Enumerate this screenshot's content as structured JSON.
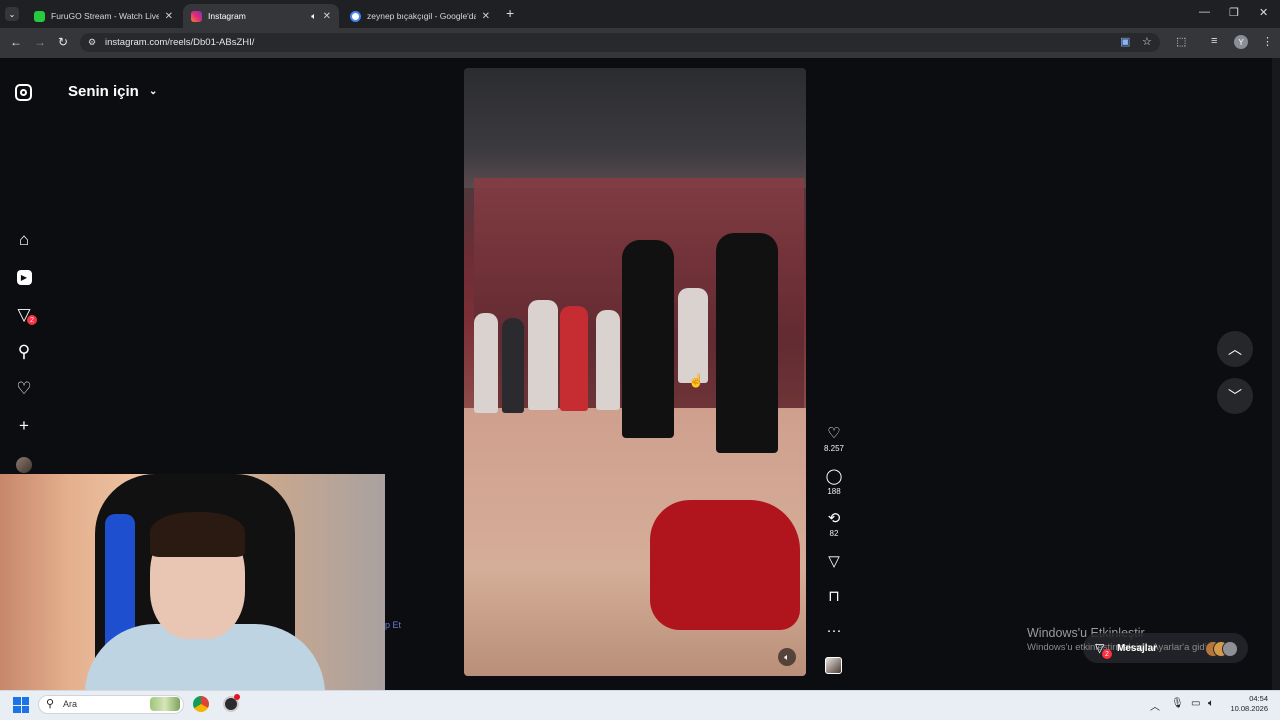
{
  "browser": {
    "tabs": [
      {
        "title": "FuruGO Stream - Watch Live on",
        "favicon_color": "#27c93f",
        "active": false
      },
      {
        "title": "Instagram",
        "favicon_color": "#e1306c",
        "active": true
      },
      {
        "title": "zeynep bıçakçıgil - Google'da A",
        "favicon_color": "#4285f4",
        "active": false
      }
    ],
    "new_tab": "+",
    "url": "instagram.com/reels/Db01-ABsZHI/",
    "profile_initial": "Y"
  },
  "instagram": {
    "feed_selector": "Senin için",
    "nav": [
      {
        "name": "home-icon",
        "glyph": "⌂"
      },
      {
        "name": "reels-icon",
        "glyph": "▶"
      },
      {
        "name": "direct-icon",
        "glyph": "▽"
      },
      {
        "name": "search-icon",
        "glyph": "⚲"
      },
      {
        "name": "heart-icon",
        "glyph": "♡"
      },
      {
        "name": "create-icon",
        "glyph": "+"
      }
    ],
    "direct_badge": "2",
    "actions": {
      "likes": "8.257",
      "comments": "188",
      "reposts": "82"
    },
    "messages": {
      "label": "Mesajlar",
      "badge": "2"
    }
  },
  "windows": {
    "watermark_title": "Windows'u Etkinleştir",
    "watermark_sub": "Windows'u etkinleştirmek için Ayarlar'a gidin.",
    "search_placeholder": "Ara",
    "time": "04:54",
    "date": "10.08.2026"
  },
  "overlay_text": "p Et",
  "colors": {
    "accent_red": "#ff3040",
    "background": "#0c0d10"
  }
}
